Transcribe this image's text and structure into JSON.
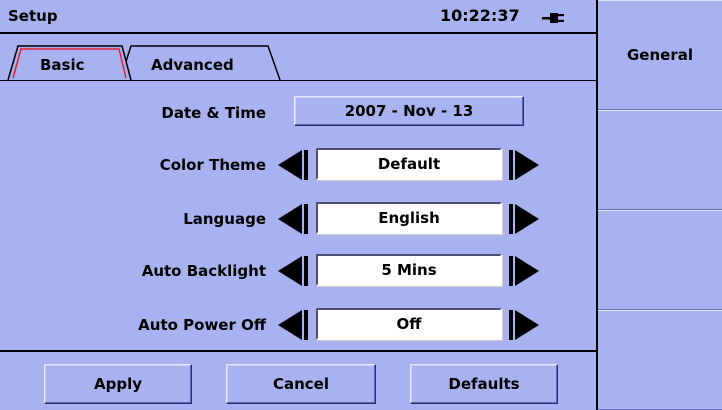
{
  "header": {
    "title": "Setup",
    "time": "10:22:37",
    "power_icon": "plug-icon"
  },
  "tabs": [
    {
      "label": "Basic",
      "active": true,
      "accent": "#e02030"
    },
    {
      "label": "Advanced",
      "active": false
    }
  ],
  "fields": {
    "date_time": {
      "label": "Date & Time",
      "value": "2007 - Nov - 13"
    },
    "color_theme": {
      "label": "Color Theme",
      "value": "Default"
    },
    "language": {
      "label": "Language",
      "value": "English"
    },
    "auto_backlight": {
      "label": "Auto Backlight",
      "value": "5 Mins"
    },
    "auto_power_off": {
      "label": "Auto Power Off",
      "value": "Off"
    }
  },
  "buttons": {
    "apply": "Apply",
    "cancel": "Cancel",
    "defaults": "Defaults"
  },
  "softkeys": [
    "General",
    "",
    "",
    ""
  ],
  "colors": {
    "background": "#a9b2f0",
    "tab_active_border": "#e02030"
  }
}
